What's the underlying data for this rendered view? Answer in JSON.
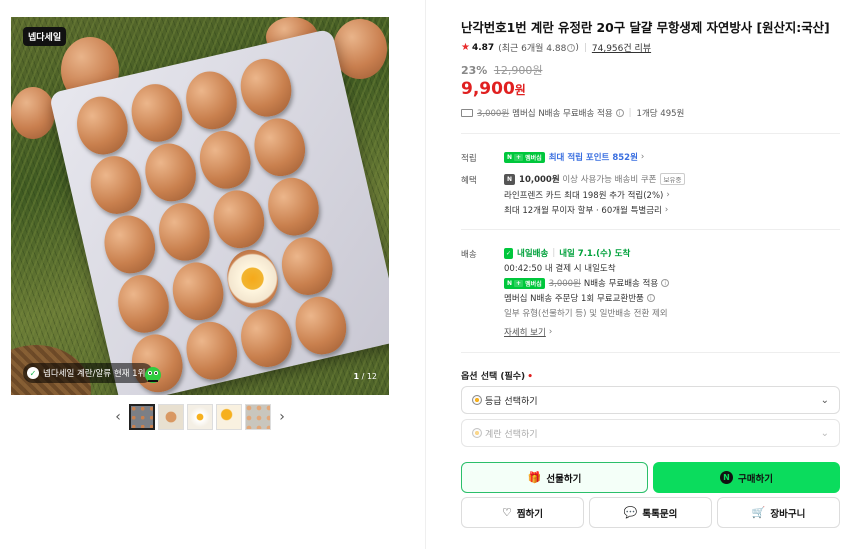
{
  "gallery": {
    "sale_badge": "넵다세일",
    "rank_pill": "넵다세일 계란/알류 현재 1위",
    "page_current": "1",
    "page_total": "/ 12",
    "prev_arrow": "‹",
    "next_arrow": "›"
  },
  "product": {
    "title": "난각번호1번 계란 유정란 20구 달걀 무항생제 자연방사 [원산지:국산]",
    "rating": "4.87",
    "rating_recent": "(최근 6개월 4.88",
    "rating_recent_close": ")",
    "review_count": "74,956건 리뷰",
    "discount_rate": "23%",
    "original_price": "12,900원",
    "price": "9,900",
    "price_unit": "원",
    "shipping_strike": "3,000원",
    "shipping_text": "멤버십 N배송 무료배송 적용",
    "per_unit": "1개당 495원"
  },
  "benefits": {
    "points_label": "적립",
    "points_badge": "멤버십",
    "points_text": "최대 적립 포인트 852원",
    "perks_label": "혜택",
    "coupon_amount": "10,000원",
    "coupon_text": "이상 사용가능 배송비 쿠폰",
    "coupon_tag": "보유중",
    "card_text": "라인프렌즈 카드 최대 198원 추가 적립(2%)",
    "installment_text": "최대 12개월 무이자 할부 · 60개월 특별금리"
  },
  "delivery": {
    "label": "배송",
    "tomorrow": "내일배송",
    "arrive": "내일 7.1.(수) 도착",
    "cutoff": "00:42:50 내 결제 시 내일도착",
    "badge": "멤버십",
    "strike": "3,000원",
    "free_text": "N배송 무료배송 적용",
    "exchange_text": "멤버십 N배송 주문당 1회 무료교환반품",
    "exclude_text": "일부 유형(선물하기 등) 및 일반배송 전환 제외",
    "more": "자세히 보기"
  },
  "options": {
    "label": "옵션 선택 (필수)",
    "required_mark": "•",
    "select1": "등급 선택하기",
    "select2": "계란 선택하기"
  },
  "actions": {
    "gift": "선물하기",
    "buy": "구매하기",
    "zzim": "찜하기",
    "talk": "톡톡문의",
    "cart": "장바구니"
  },
  "colors": {
    "price_red": "#e02020",
    "naver_green": "#0bdc5d",
    "point_blue": "#3a6fe0"
  }
}
